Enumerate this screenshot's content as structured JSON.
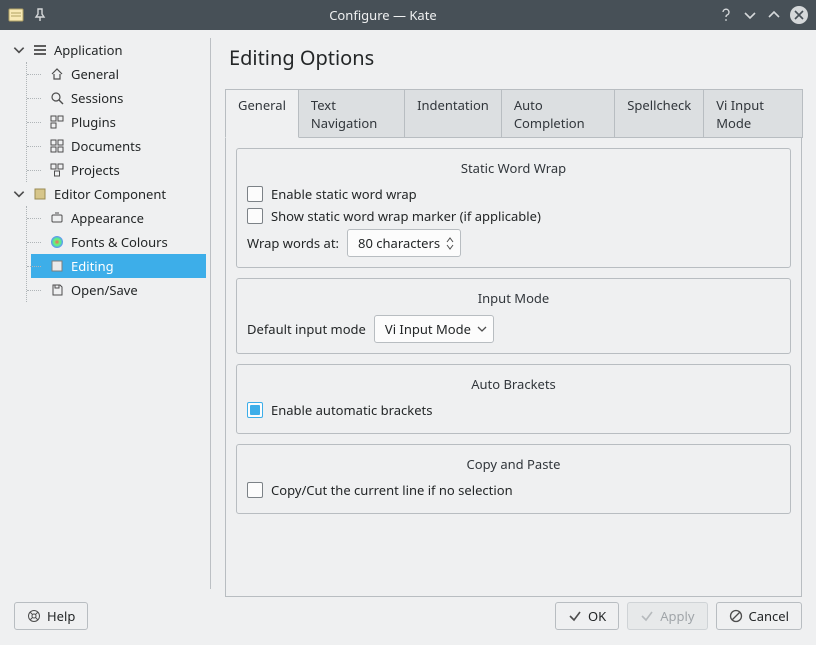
{
  "window": {
    "title": "Configure — Kate"
  },
  "sidebar": {
    "sections": [
      {
        "label": "Application",
        "icon": "application-icon",
        "items": [
          {
            "label": "General",
            "icon": "home-icon"
          },
          {
            "label": "Sessions",
            "icon": "search-icon"
          },
          {
            "label": "Plugins",
            "icon": "plugin-icon"
          },
          {
            "label": "Documents",
            "icon": "documents-icon"
          },
          {
            "label": "Projects",
            "icon": "projects-icon"
          }
        ]
      },
      {
        "label": "Editor Component",
        "icon": "editor-icon",
        "items": [
          {
            "label": "Appearance",
            "icon": "appearance-icon"
          },
          {
            "label": "Fonts & Colours",
            "icon": "fonts-colours-icon"
          },
          {
            "label": "Editing",
            "icon": "editing-icon",
            "selected": true
          },
          {
            "label": "Open/Save",
            "icon": "save-icon"
          }
        ]
      }
    ]
  },
  "page": {
    "title": "Editing Options"
  },
  "tabs": [
    {
      "label": "General",
      "active": true
    },
    {
      "label": "Text Navigation"
    },
    {
      "label": "Indentation"
    },
    {
      "label": "Auto Completion"
    },
    {
      "label": "Spellcheck"
    },
    {
      "label": "Vi Input Mode"
    }
  ],
  "groups": {
    "static_wrap": {
      "title": "Static Word Wrap",
      "enable_label": "Enable static word wrap",
      "enable_checked": false,
      "show_marker_label": "Show static word wrap marker (if applicable)",
      "show_marker_checked": false,
      "wrap_label": "Wrap words at:",
      "wrap_value": "80 characters"
    },
    "input_mode": {
      "title": "Input Mode",
      "default_label": "Default input mode",
      "default_value": "Vi Input Mode"
    },
    "auto_brackets": {
      "title": "Auto Brackets",
      "enable_label": "Enable automatic brackets",
      "enable_checked": true
    },
    "copy_paste": {
      "title": "Copy and Paste",
      "copy_cut_label": "Copy/Cut the current line if no selection",
      "copy_cut_checked": false
    }
  },
  "footer": {
    "help": "Help",
    "ok": "OK",
    "apply": "Apply",
    "cancel": "Cancel"
  }
}
